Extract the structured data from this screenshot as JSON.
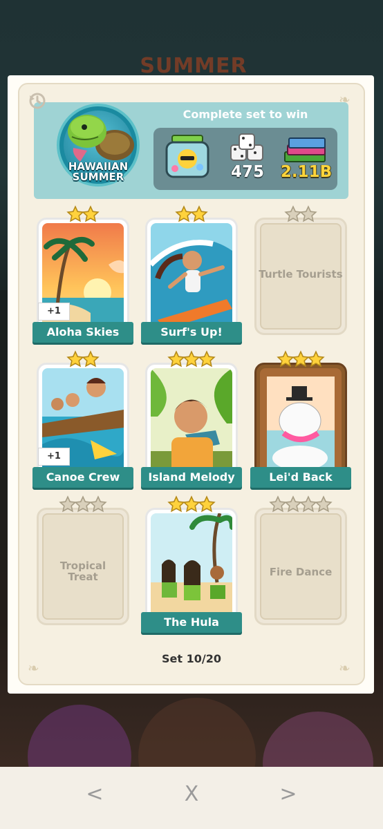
{
  "header": {
    "title_top": "HAWAIIAN",
    "title_bottom": "SUMMER",
    "complete_text": "Complete set to win",
    "rewards": {
      "dice": "475",
      "cash": "2.11B"
    }
  },
  "cards": [
    {
      "name": "Aloha Skies",
      "stars": 2,
      "collected": true,
      "extra": "+1"
    },
    {
      "name": "Surf's Up!",
      "stars": 2,
      "collected": true,
      "extra": ""
    },
    {
      "name": "Turtle Tourists",
      "stars": 2,
      "collected": false,
      "extra": ""
    },
    {
      "name": "Canoe Crew",
      "stars": 2,
      "collected": true,
      "extra": "+1"
    },
    {
      "name": "Island Melody",
      "stars": 3,
      "collected": true,
      "extra": ""
    },
    {
      "name": "Lei'd Back",
      "stars": 3,
      "collected": true,
      "extra": ""
    },
    {
      "name": "Tropical Treat",
      "stars": 3,
      "collected": false,
      "extra": ""
    },
    {
      "name": "The Hula",
      "stars": 3,
      "collected": true,
      "extra": ""
    },
    {
      "name": "Fire Dance",
      "stars": 4,
      "collected": false,
      "extra": ""
    }
  ],
  "set_counter": "Set 10/20",
  "background_title": "SUMMER",
  "nav": {
    "prev": "<",
    "close": "X",
    "next": ">"
  },
  "colors": {
    "ribbon": "#2e8e88",
    "header_bg": "#9fd3d4",
    "star_gold": "#ffd23c",
    "star_empty": "#d9d0bb"
  }
}
